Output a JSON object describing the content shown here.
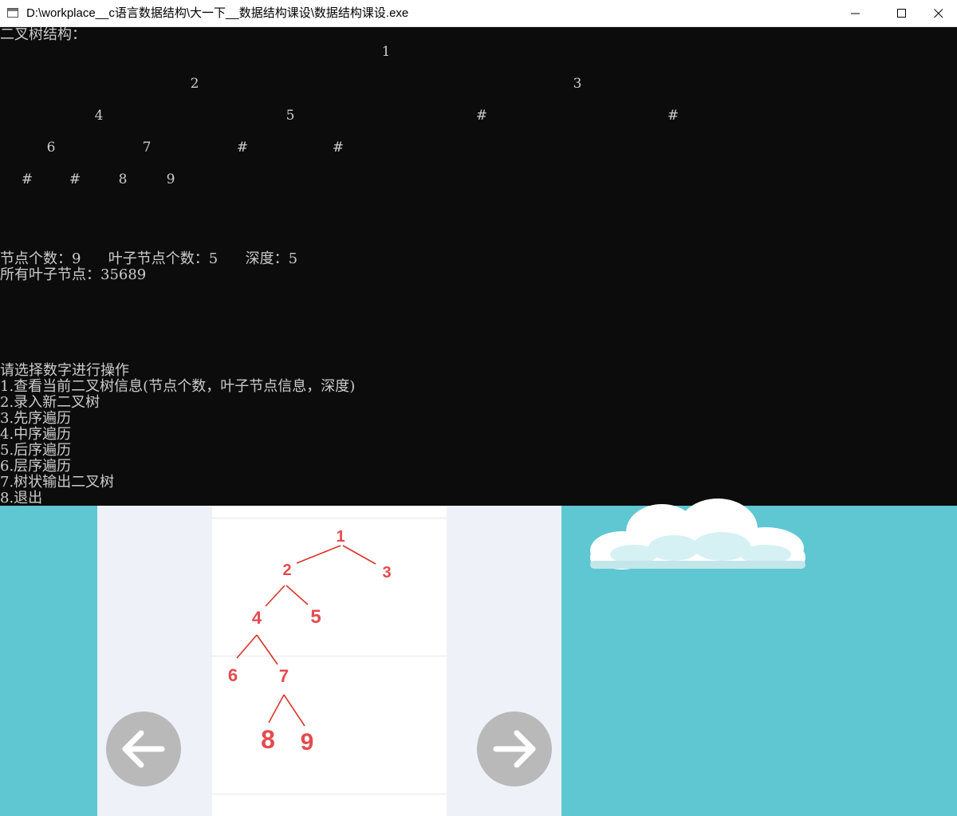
{
  "window": {
    "title": "D:\\workplace__c语言数据结构\\大一下__数据结构课设\\数据结构课设.exe"
  },
  "console": {
    "heading": "二叉树结构：",
    "tree_rows": [
      [
        "1"
      ],
      [
        "2",
        "3"
      ],
      [
        "4",
        "5",
        "#",
        "#"
      ],
      [
        "6",
        "7",
        "#",
        "#"
      ],
      [
        "#",
        "#",
        "8",
        "9"
      ]
    ],
    "stats_line": "节点个数：9      叶子节点个数：5      深度：5",
    "leaves_line": "所有叶子节点：35689",
    "prompt": "请选择数字进行操作",
    "menu": [
      "1.查看当前二叉树信息(节点个数，叶子节点信息，深度)",
      "2.录入新二叉树",
      "3.先序遍历",
      "4.中序遍历",
      "5.后序遍历",
      "6.层序遍历",
      "7.树状输出二叉树",
      "8.退出"
    ]
  },
  "background_app": {
    "tree_labels": [
      "1",
      "2",
      "3",
      "4",
      "5",
      "6",
      "7",
      "8",
      "9"
    ],
    "tree_color": "#e34b4f",
    "prev_icon": "arrow-left-icon",
    "next_icon": "arrow-right-icon"
  }
}
